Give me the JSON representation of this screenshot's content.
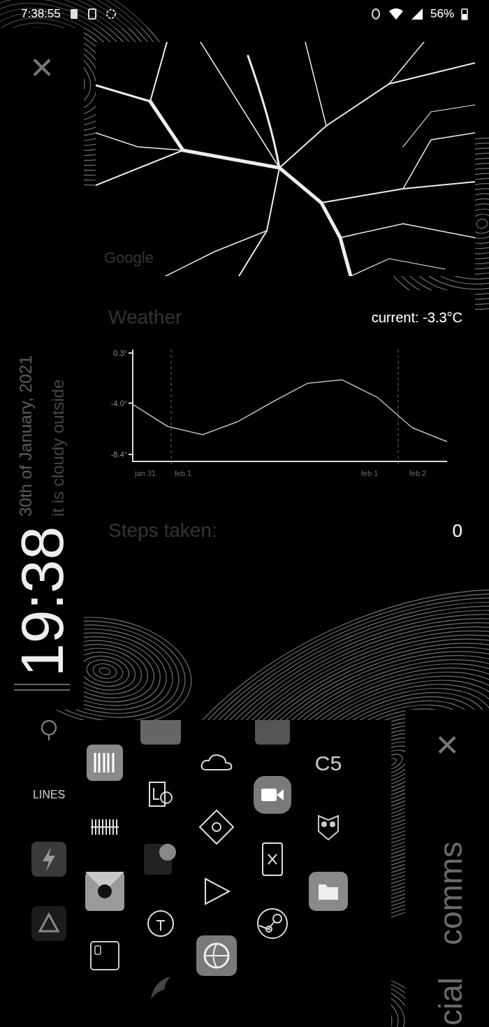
{
  "status_bar": {
    "time": "7:38:55",
    "battery": "56%"
  },
  "left_panel": {
    "close": "×",
    "clock": "19:38",
    "date": "30th of January, 2021",
    "condition": "it is cloudy outside"
  },
  "map": {
    "attribution": "Google"
  },
  "weather": {
    "title": "Weather",
    "current": "current: -3.3°C",
    "chart": {
      "y_ticks": [
        "0.3°",
        "-4.0°",
        "-8.4°"
      ],
      "x_labels": [
        "jan 31",
        "feb 1",
        "feb 1",
        "feb 2"
      ],
      "series": [
        {
          "values": [
            -4.1,
            -6.0,
            -6.7,
            -5.6,
            -3.9,
            -2.3,
            -2.0,
            -3.5,
            -6.1,
            -7.3
          ]
        }
      ]
    }
  },
  "steps": {
    "label": "Steps taken:",
    "value": "0"
  },
  "app_drawer": {
    "labels": [
      "LINES",
      "C5"
    ]
  },
  "right_panel": {
    "close": "×",
    "sections": [
      "cial",
      "comms"
    ]
  }
}
